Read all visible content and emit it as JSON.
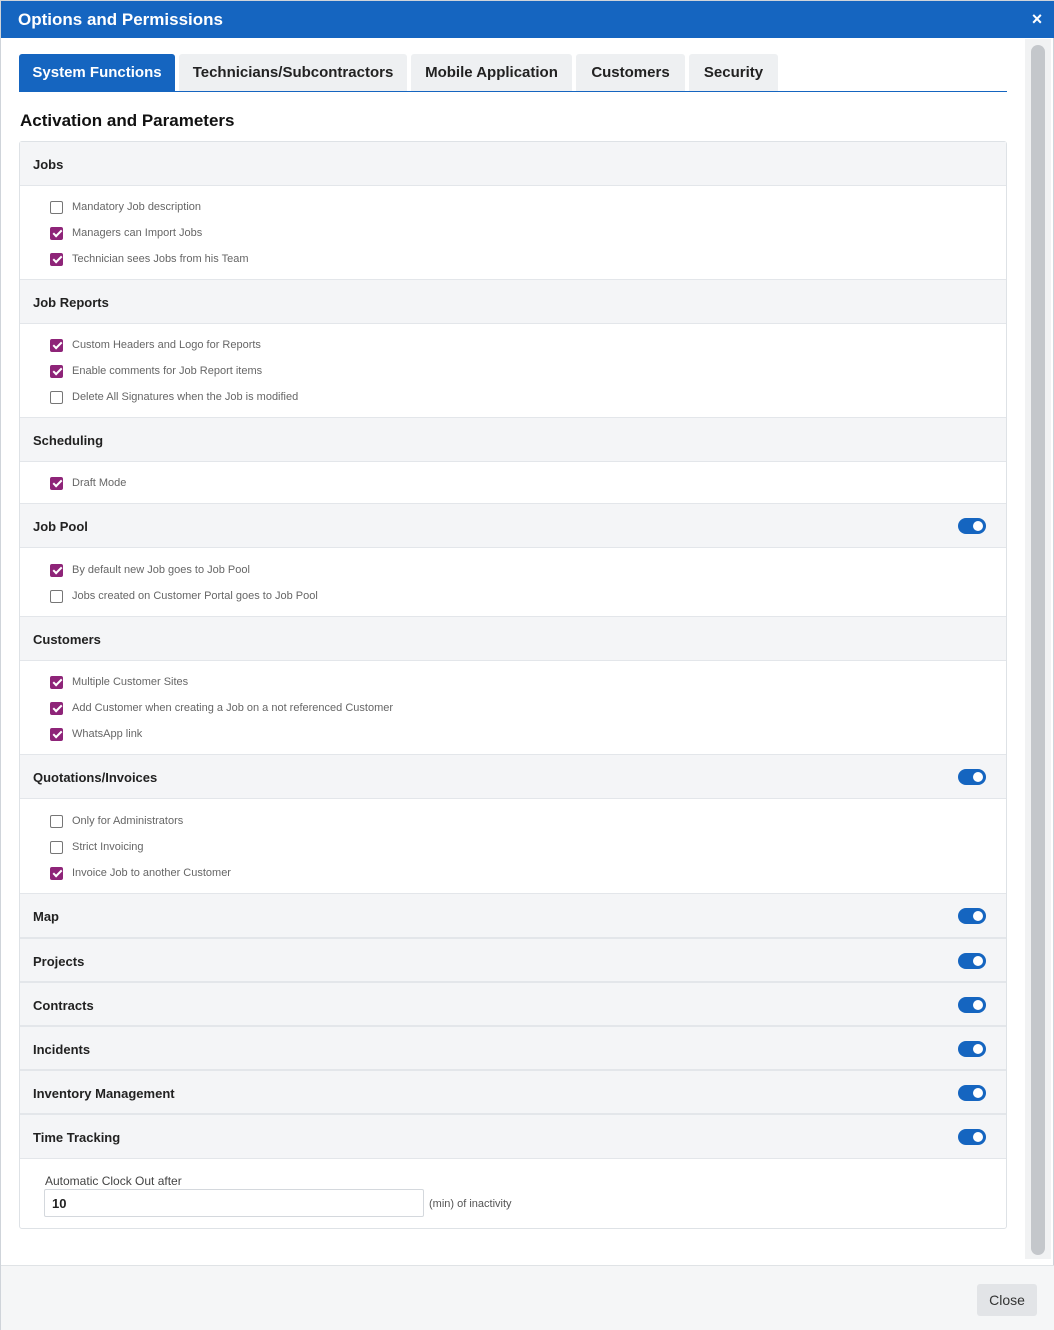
{
  "window": {
    "title": "Options and Permissions",
    "close_symbol": "×"
  },
  "tabs": [
    {
      "label": "System Functions",
      "active": true
    },
    {
      "label": "Technicians/Subcontractors",
      "active": false
    },
    {
      "label": "Mobile Application",
      "active": false
    },
    {
      "label": "Customers",
      "active": false
    },
    {
      "label": "Security",
      "active": false
    }
  ],
  "section_title": "Activation and Parameters",
  "groups": {
    "jobs": {
      "label": "Jobs",
      "options": [
        {
          "label": "Mandatory Job description",
          "checked": false
        },
        {
          "label": "Managers can Import Jobs",
          "checked": true
        },
        {
          "label": "Technician sees Jobs from his Team",
          "checked": true
        }
      ]
    },
    "job_reports": {
      "label": "Job Reports",
      "options": [
        {
          "label": "Custom Headers and Logo for Reports",
          "checked": true
        },
        {
          "label": "Enable comments for Job Report items",
          "checked": true
        },
        {
          "label": "Delete All Signatures when the Job is modified",
          "checked": false
        }
      ]
    },
    "scheduling": {
      "label": "Scheduling",
      "options": [
        {
          "label": "Draft Mode",
          "checked": true
        }
      ]
    },
    "job_pool": {
      "label": "Job Pool",
      "enabled": true,
      "options": [
        {
          "label": "By default new Job goes to Job Pool",
          "checked": true
        },
        {
          "label": "Jobs created on Customer Portal goes to Job Pool",
          "checked": false
        }
      ]
    },
    "customers": {
      "label": "Customers",
      "options": [
        {
          "label": "Multiple Customer Sites",
          "checked": true
        },
        {
          "label": "Add Customer when creating a Job on a not referenced Customer",
          "checked": true
        },
        {
          "label": "WhatsApp link",
          "checked": true
        }
      ]
    },
    "quotations": {
      "label": "Quotations/Invoices",
      "enabled": true,
      "options": [
        {
          "label": "Only for Administrators",
          "checked": false
        },
        {
          "label": "Strict Invoicing",
          "checked": false
        },
        {
          "label": "Invoice Job to another Customer",
          "checked": true
        }
      ]
    },
    "map": {
      "label": "Map",
      "enabled": true
    },
    "projects": {
      "label": "Projects",
      "enabled": true
    },
    "contracts": {
      "label": "Contracts",
      "enabled": true
    },
    "incidents": {
      "label": "Incidents",
      "enabled": true
    },
    "inventory": {
      "label": "Inventory Management",
      "enabled": true
    },
    "time_tracking": {
      "label": "Time Tracking",
      "enabled": true
    }
  },
  "clock_out": {
    "label": "Automatic Clock Out after",
    "value": "10",
    "suffix": "(min) of inactivity"
  },
  "footer": {
    "close_label": "Close"
  },
  "colors": {
    "primary": "#1565c0",
    "checkbox_checked": "#8e2478",
    "header_bg": "#f4f5f7"
  }
}
